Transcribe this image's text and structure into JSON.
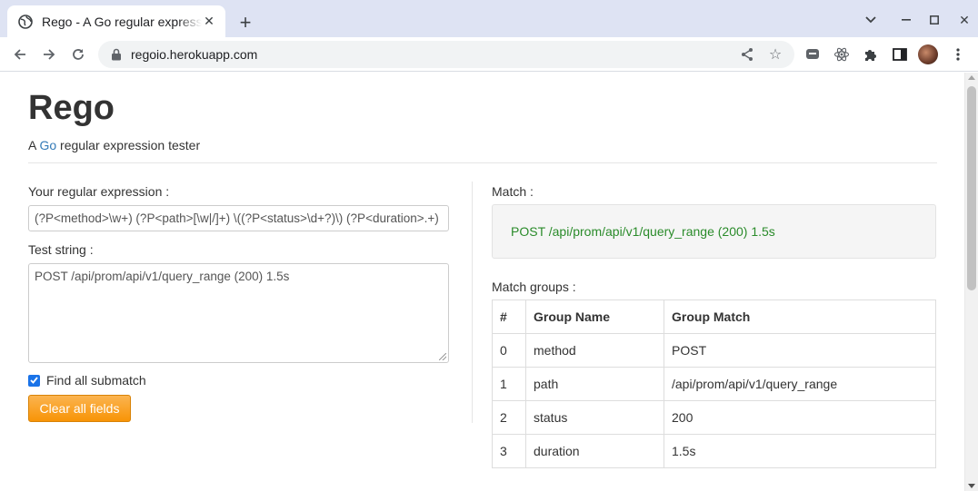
{
  "browser": {
    "tab_title": "Rego - A Go regular expression tester",
    "url": "regoio.herokuapp.com"
  },
  "page": {
    "title": "Rego",
    "tagline_prefix": "A ",
    "tagline_link": "Go",
    "tagline_suffix": " regular expression tester"
  },
  "form": {
    "regex_label": "Your regular expression :",
    "regex_value": "(?P<method>\\w+) (?P<path>[\\w|/]+) \\((?P<status>\\d+?)\\) (?P<duration>.+)",
    "test_label": "Test string :",
    "test_value": "POST /api/prom/api/v1/query_range (200) 1.5s",
    "find_all_label": "Find all submatch",
    "find_all_checked": true,
    "clear_button": "Clear all fields"
  },
  "result": {
    "match_label": "Match :",
    "match_text": "POST /api/prom/api/v1/query_range (200) 1.5s",
    "groups_label": "Match groups :",
    "columns": [
      "#",
      "Group Name",
      "Group Match"
    ],
    "rows": [
      [
        "0",
        "method",
        "POST"
      ],
      [
        "1",
        "path",
        "/api/prom/api/v1/query_range"
      ],
      [
        "2",
        "status",
        "200"
      ],
      [
        "3",
        "duration",
        "1.5s"
      ]
    ]
  },
  "colors": {
    "match_text": "#2a8b2a",
    "link": "#337ab7",
    "button": "#f89406"
  }
}
